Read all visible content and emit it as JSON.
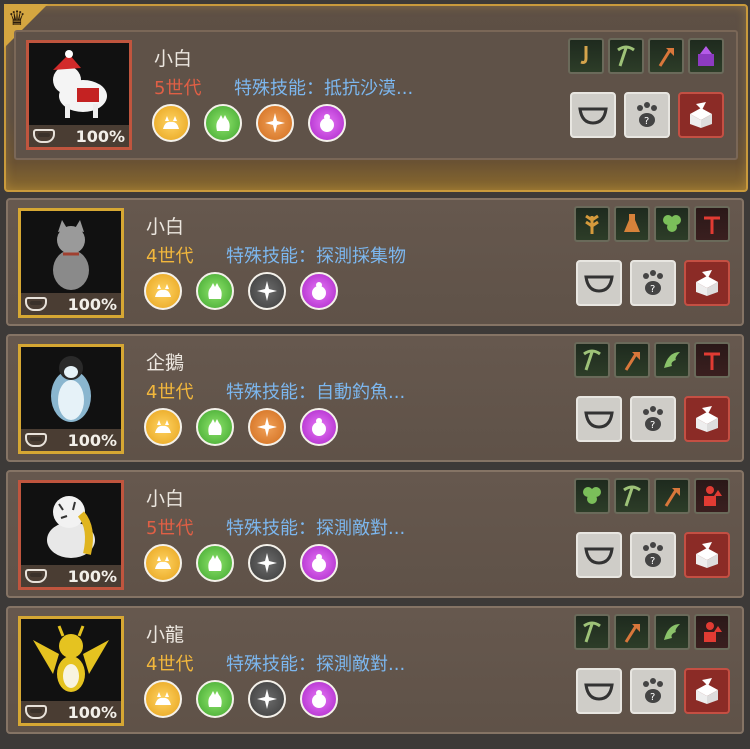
{
  "pets": [
    {
      "name": "小白",
      "generation": "5世代",
      "gen_level": 5,
      "skill_text": "特殊技能：抵抗沙漠...",
      "feed": "100%",
      "pet_art": "white-dog-santa",
      "selected": true,
      "traits": [
        "yellow-cat",
        "green-hand",
        "orange-compass",
        "purple-bag"
      ],
      "skill_icons": [
        "fishing-hook-icon",
        "pickaxe-icon",
        "axe-icon",
        "purple-pickaxe-icon"
      ]
    },
    {
      "name": "小白",
      "generation": "4世代",
      "gen_level": 4,
      "skill_text": "特殊技能：探測採集物",
      "feed": "100%",
      "pet_art": "grey-cat",
      "selected": false,
      "traits": [
        "yellow-cat",
        "green-hand",
        "grey-compass",
        "purple-bag"
      ],
      "skill_icons": [
        "wheat-icon",
        "flask-icon",
        "clover-icon",
        "red-hoe-icon"
      ]
    },
    {
      "name": "企鵝",
      "generation": "4世代",
      "gen_level": 4,
      "skill_text": "特殊技能：自動釣魚...",
      "feed": "100%",
      "pet_art": "penguin",
      "selected": false,
      "traits": [
        "yellow-cat",
        "green-hand",
        "orange-compass",
        "purple-bag"
      ],
      "skill_icons": [
        "pickaxe-icon",
        "axe-icon",
        "wing-icon",
        "red-hoe-icon"
      ]
    },
    {
      "name": "小白",
      "generation": "5世代",
      "gen_level": 5,
      "skill_text": "特殊技能：探測敵對...",
      "feed": "100%",
      "pet_art": "white-tiger",
      "selected": false,
      "traits": [
        "yellow-cat",
        "green-hand",
        "grey-compass",
        "purple-bag"
      ],
      "skill_icons": [
        "clover-icon",
        "pickaxe-icon",
        "axe-icon",
        "red-person-icon"
      ]
    },
    {
      "name": "小龍",
      "generation": "4世代",
      "gen_level": 4,
      "skill_text": "特殊技能：探測敵對...",
      "feed": "100%",
      "pet_art": "gold-dragon",
      "selected": false,
      "traits": [
        "yellow-cat",
        "green-hand",
        "grey-compass",
        "purple-bag"
      ],
      "skill_icons": [
        "pickaxe-icon",
        "axe-icon",
        "wing-icon",
        "red-person-icon"
      ]
    }
  ],
  "colors": {
    "gen4": "#f2b73c",
    "gen5": "#e05f45",
    "skill_text": "#7cb7ef",
    "selected_border": "#c99a3c"
  }
}
